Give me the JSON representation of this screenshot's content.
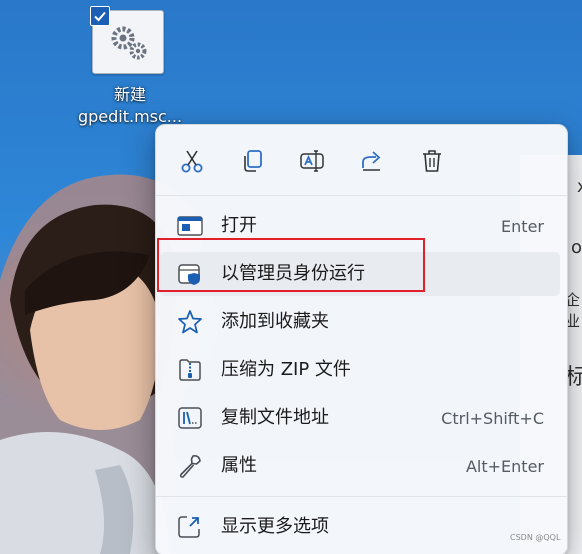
{
  "desktop_icon": {
    "label_line1": "新建",
    "label_line2": "gpedit.msc..."
  },
  "context_menu": {
    "quick_actions": [
      {
        "name": "cut-icon"
      },
      {
        "name": "copy-icon"
      },
      {
        "name": "rename-icon"
      },
      {
        "name": "share-icon"
      },
      {
        "name": "delete-icon"
      }
    ],
    "items": [
      {
        "label": "打开",
        "shortcut": "Enter",
        "icon": "open-window-icon"
      },
      {
        "label": "以管理员身份运行",
        "shortcut": "",
        "icon": "admin-shield-icon"
      },
      {
        "label": "添加到收藏夹",
        "shortcut": "",
        "icon": "star-icon"
      },
      {
        "label": "压缩为 ZIP 文件",
        "shortcut": "",
        "icon": "zip-folder-icon"
      },
      {
        "label": "复制文件地址",
        "shortcut": "Ctrl+Shift+C",
        "icon": "copy-path-icon"
      },
      {
        "label": "属性",
        "shortcut": "Alt+Enter",
        "icon": "wrench-icon"
      },
      {
        "label": "显示更多选项",
        "shortcut": "",
        "icon": "more-options-icon"
      }
    ]
  },
  "background_window": {
    "glyph_1": "x",
    "glyph_2": "on",
    "glyph_3": "企业",
    "glyph_4": "标"
  },
  "watermark": "CSDN @QQL",
  "colors": {
    "accent": "#1a5fb4",
    "highlight_border": "#e0202a",
    "menu_bg": "#f6f8fb"
  }
}
